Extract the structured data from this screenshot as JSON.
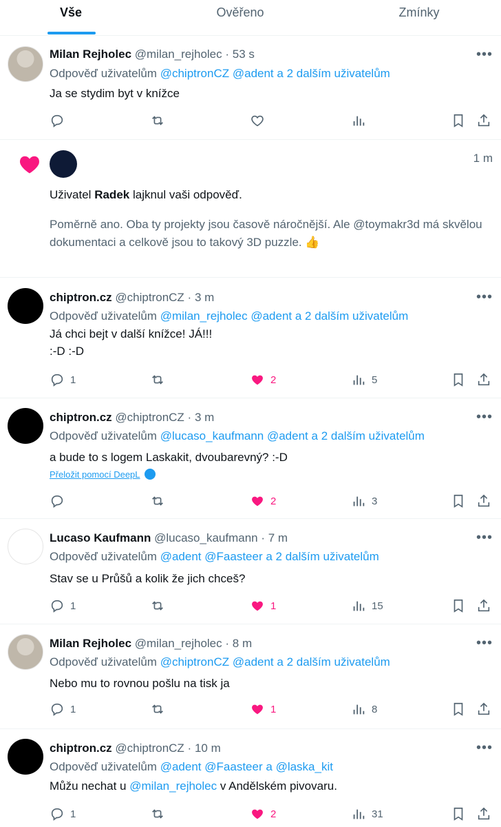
{
  "tabs": [
    {
      "label": "Vše",
      "active": true
    },
    {
      "label": "Ověřeno",
      "active": false
    },
    {
      "label": "Zmínky",
      "active": false
    }
  ],
  "reply_prefix": "Odpověď uživatelům",
  "posts": [
    {
      "name": "Milan Rejholec",
      "handle": "@milan_rejholec",
      "time": "53 s",
      "mentions": [
        "@chiptronCZ",
        "@adent",
        "a 2 dalším uživatelům"
      ],
      "text": [
        "Ja se stydim byt v knížce"
      ],
      "replies": "",
      "likes": "",
      "liked": false,
      "views": ""
    },
    {
      "name": "chiptron.cz",
      "handle": "@chiptronCZ",
      "time": "3 m",
      "mentions": [
        "@milan_rejholec",
        "@adent",
        "a 2 dalším uživatelům"
      ],
      "text": [
        "Já chci bejt v další knížce! JÁ!!!",
        ":-D :-D"
      ],
      "replies": "1",
      "likes": "2",
      "liked": true,
      "views": "5"
    },
    {
      "name": "chiptron.cz",
      "handle": "@chiptronCZ",
      "time": "3 m",
      "mentions": [
        "@lucaso_kaufmann",
        "@adent",
        "a 2 dalším uživatelům"
      ],
      "text": [
        "a bude to s logem Laskakit, dvoubarevný? :-D"
      ],
      "translate": "Přeložit pomocí DeepL",
      "replies": "",
      "likes": "2",
      "liked": true,
      "views": "3"
    },
    {
      "name": "Lucaso Kaufmann",
      "handle": "@lucaso_kaufmann",
      "time": "7 m",
      "mentions": [
        "@adent",
        "@Faasteer",
        "a 2 dalším uživatelům"
      ],
      "text": [
        "Stav se u Průšů a kolik že jich chceš?"
      ],
      "replies": "1",
      "likes": "1",
      "liked": true,
      "views": "15"
    },
    {
      "name": "Milan Rejholec",
      "handle": "@milan_rejholec",
      "time": "8 m",
      "mentions": [
        "@chiptronCZ",
        "@adent",
        "a 2 dalším uživatelům"
      ],
      "text": [
        "Nebo mu to rovnou pošlu na tisk ja"
      ],
      "replies": "1",
      "likes": "1",
      "liked": true,
      "views": "8"
    },
    {
      "name": "chiptron.cz",
      "handle": "@chiptronCZ",
      "time": "10 m",
      "mentions": [
        "@adent",
        "@Faasteer",
        "a",
        "@laska_kit"
      ],
      "text_parts": [
        "Můžu nechat u ",
        "@milan_rejholec",
        " v Andělském pivovaru."
      ],
      "replies": "1",
      "likes": "2",
      "liked": true,
      "views": "31"
    }
  ],
  "notification": {
    "time": "1 m",
    "prefix": "Uživatel",
    "user": "Radek",
    "action": "lajknul vaši odpověď.",
    "quote": "Poměrně ano. Oba ty projekty jsou časově náročnější. Ale @toymakr3d má skvělou dokumentaci a celkově jsou to takový 3D puzzle. 👍"
  },
  "colors": {
    "accent": "#1d9bf0",
    "like": "#f91880",
    "secondary": "#536471"
  },
  "icons": {
    "reply": "reply-icon",
    "retweet": "retweet-icon",
    "like": "heart-icon",
    "views": "views-icon",
    "bookmark": "bookmark-icon",
    "share": "share-icon",
    "more": "more-icon"
  }
}
